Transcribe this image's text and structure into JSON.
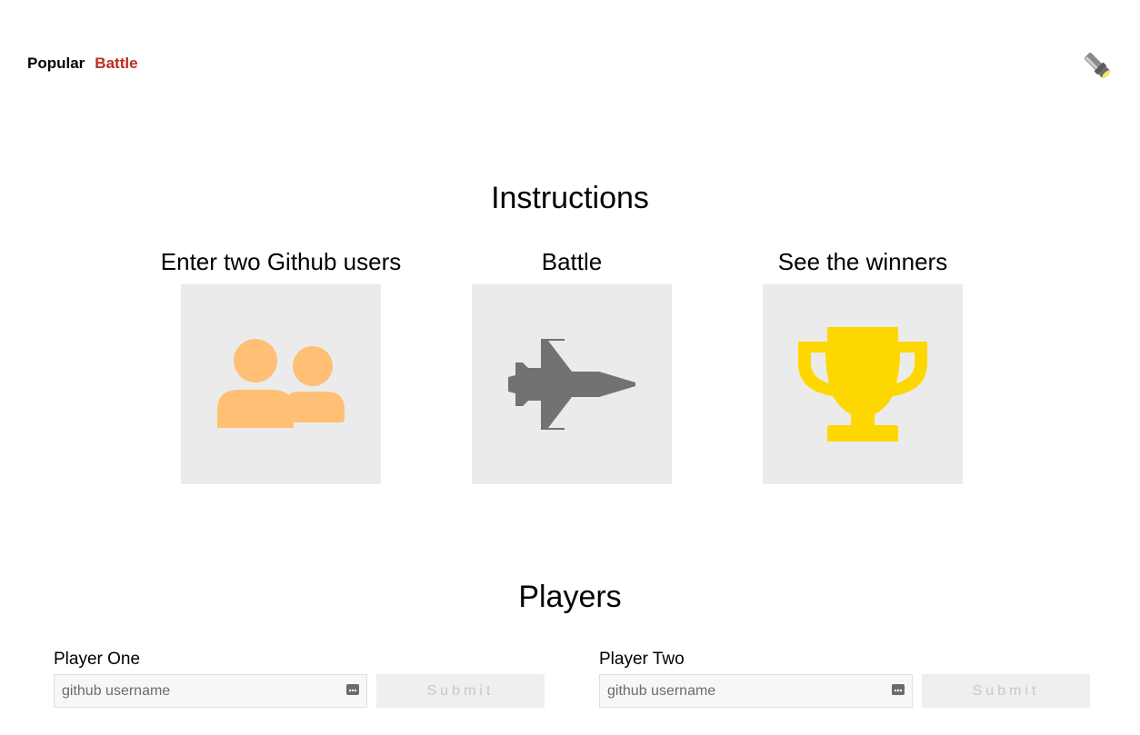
{
  "nav": {
    "items": [
      {
        "label": "Popular",
        "active": false
      },
      {
        "label": "Battle",
        "active": true
      }
    ],
    "theme_toggle_icon": "flashlight-icon"
  },
  "instructions": {
    "title": "Instructions",
    "steps": [
      {
        "title": "Enter two Github users",
        "icon": "users-icon",
        "color": "#ffbf74"
      },
      {
        "title": "Battle",
        "icon": "fighter-jet-icon",
        "color": "#727272"
      },
      {
        "title": "See the winners",
        "icon": "trophy-icon",
        "color": "#ffd700"
      }
    ]
  },
  "players": {
    "title": "Players",
    "forms": [
      {
        "label": "Player One",
        "placeholder": "github username",
        "value": "",
        "submit_label": "Submit",
        "submit_disabled": true
      },
      {
        "label": "Player Two",
        "placeholder": "github username",
        "value": "",
        "submit_label": "Submit",
        "submit_disabled": true
      }
    ]
  },
  "colors": {
    "accent": "#bb2e1f",
    "box_bg": "#ebebeb"
  }
}
